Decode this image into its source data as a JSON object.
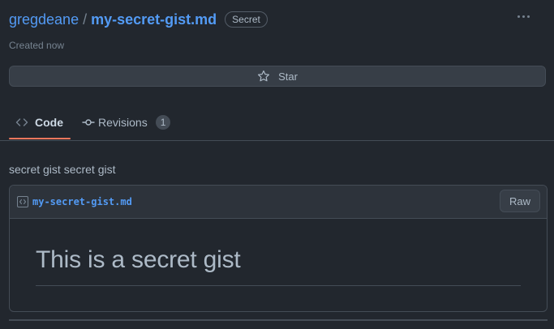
{
  "header": {
    "owner": "gregdeane",
    "separator": "/",
    "filename": "my-secret-gist.md",
    "badge": "Secret",
    "created": "Created now"
  },
  "actions": {
    "star_label": "Star"
  },
  "tabs": [
    {
      "label": "Code",
      "icon": "code-icon",
      "active": true
    },
    {
      "label": "Revisions",
      "icon": "git-commit-icon",
      "count": "1"
    }
  ],
  "description": "secret gist secret gist",
  "file": {
    "name": "my-secret-gist.md",
    "raw_label": "Raw",
    "heading": "This is a secret gist"
  },
  "colors": {
    "background": "#22272e",
    "link": "#539bf5",
    "active_tab_underline": "#ec775c"
  }
}
